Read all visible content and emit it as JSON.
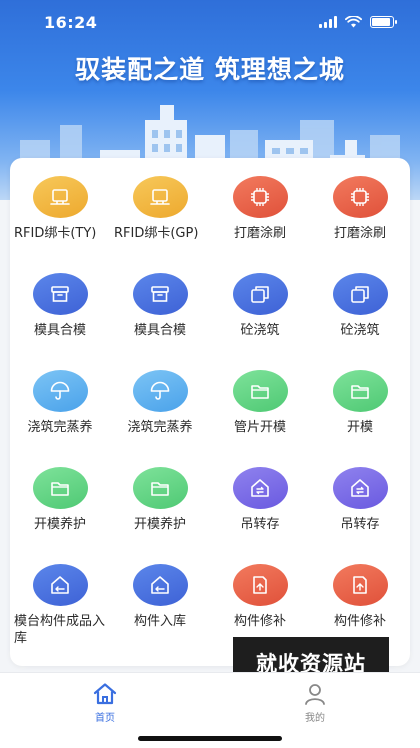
{
  "status_bar": {
    "time": "16:24",
    "battery_level": 0.9
  },
  "hero": {
    "slogan": "驭装配之道  筑理想之城"
  },
  "grid": {
    "items": [
      {
        "label": "RFID绑卡(TY)",
        "icon": "card-reader-icon",
        "color": "#eda92e"
      },
      {
        "label": "RFID绑卡(GP)",
        "icon": "card-reader-icon",
        "color": "#eda92e"
      },
      {
        "label": "打磨涂刷",
        "icon": "grinder-icon",
        "color": "#e0513a"
      },
      {
        "label": "打磨涂刷",
        "icon": "grinder-icon",
        "color": "#e0513a"
      },
      {
        "label": "模具合模",
        "icon": "mold-box-icon",
        "color": "#3e62d6"
      },
      {
        "label": "模具合模",
        "icon": "mold-box-icon",
        "color": "#3e62d6"
      },
      {
        "label": "砼浇筑",
        "icon": "layers-icon",
        "color": "#3e62d6"
      },
      {
        "label": "砼浇筑",
        "icon": "layers-icon",
        "color": "#3e62d6"
      },
      {
        "label": "浇筑完蒸养",
        "icon": "umbrella-icon",
        "color": "#4aa2ea"
      },
      {
        "label": "浇筑完蒸养",
        "icon": "umbrella-icon",
        "color": "#4aa2ea"
      },
      {
        "label": "管片开模",
        "icon": "folder-icon",
        "color": "#4fc974"
      },
      {
        "label": "开模",
        "icon": "folder-icon",
        "color": "#4fc974"
      },
      {
        "label": "开模养护",
        "icon": "folder-icon",
        "color": "#4fc974"
      },
      {
        "label": "开模养护",
        "icon": "folder-icon",
        "color": "#4fc974"
      },
      {
        "label": "吊转存",
        "icon": "warehouse-transfer-icon",
        "color": "#6a5ae0"
      },
      {
        "label": "吊转存",
        "icon": "warehouse-transfer-icon",
        "color": "#6a5ae0"
      },
      {
        "label": "模台构件成品入库",
        "icon": "warehouse-inbound-icon",
        "color": "#3e62d6"
      },
      {
        "label": "构件入库",
        "icon": "warehouse-inbound-icon",
        "color": "#3e62d6"
      },
      {
        "label": "构件修补",
        "icon": "repair-doc-icon",
        "color": "#e0513a"
      },
      {
        "label": "构件修补",
        "icon": "repair-doc-icon",
        "color": "#e0513a"
      }
    ]
  },
  "watermark": {
    "text": "就收资源站"
  },
  "tabbar": {
    "home_label": "首页",
    "mine_label": "我的",
    "active": "home",
    "accent": "#3a6fe0"
  }
}
